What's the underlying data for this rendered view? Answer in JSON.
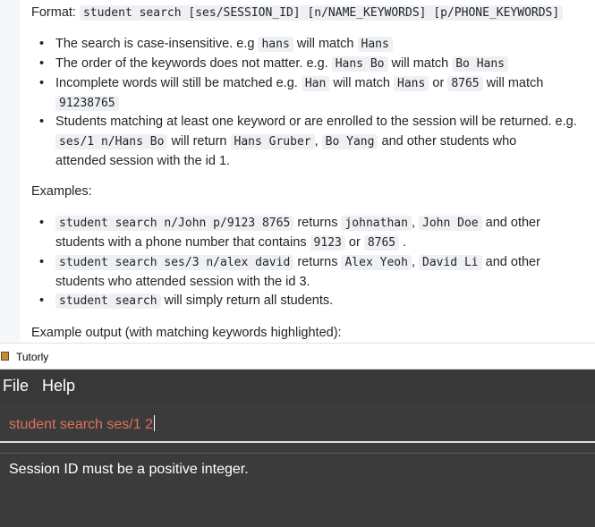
{
  "doc": {
    "format_label": "Format:",
    "format_code": "student search [ses/SESSION_ID] [n/NAME_KEYWORDS] [p/PHONE_KEYWORDS]",
    "bullets": [
      {
        "t1": "The search is case-insensitive. e.g",
        "c1": "hans",
        "t2": "will match",
        "c2": "Hans"
      },
      {
        "t1": "The order of the keywords does not matter. e.g.",
        "c1": "Hans Bo",
        "t2": "will match",
        "c2": "Bo Hans"
      },
      {
        "t1": "Incomplete words will still be matched e.g.",
        "c1": "Han",
        "t2": "will match",
        "c2": "Hans",
        "t3": "or",
        "c3": "8765",
        "t4": "will match",
        "c4": "91238765"
      },
      {
        "t1": "Students matching at least one keyword or are enrolled to the session will be returned. e.g.",
        "c1": "ses/1 n/Hans Bo",
        "t2": "will return",
        "c2": "Hans Gruber",
        "t3": ",",
        "c3": "Bo Yang",
        "t4": "and other students who",
        "t5": "attended session with the id 1."
      }
    ],
    "examples_label": "Examples:",
    "examples": [
      {
        "c1": "student search n/John p/9123 8765",
        "t1": "returns",
        "c2": "johnathan",
        "t2": ",",
        "c3": "John Doe",
        "t3": "and other",
        "t4": "students with a phone number that contains",
        "c4": "9123",
        "t5": "or",
        "c5": "8765",
        "t6": "."
      },
      {
        "c1": "student search ses/3 n/alex david",
        "t1": "returns",
        "c2": "Alex Yeoh",
        "t2": ",",
        "c3": "David Li",
        "t3": "and other",
        "t4": "students who attended session with the id 3."
      },
      {
        "c1": "student search",
        "t1": "will simply return all students."
      }
    ],
    "output_label": "Example output (with matching keywords highlighted):"
  },
  "window": {
    "title": "Tutorly"
  },
  "menu": {
    "file": "File",
    "help": "Help"
  },
  "command": {
    "value": "student search ses/1 2"
  },
  "result": {
    "message": "Session ID must be a positive integer."
  },
  "colors": {
    "command_text": "#e0705a",
    "app_bg": "#3b3b3b"
  }
}
